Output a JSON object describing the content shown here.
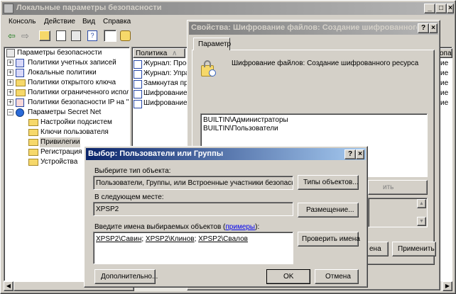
{
  "main": {
    "title": "Локальные параметры безопасности",
    "menu": [
      "Консоль",
      "Действие",
      "Вид",
      "Справка"
    ],
    "tree": [
      {
        "label": "Параметры безопасности",
        "level": 0
      },
      {
        "label": "Политики учетных записей",
        "level": 1
      },
      {
        "label": "Локальные политики",
        "level": 1
      },
      {
        "label": "Политики открытого ключа",
        "level": 1
      },
      {
        "label": "Политики ограниченного использ...",
        "level": 1
      },
      {
        "label": "Политики безопасности IP на \"Ло...",
        "level": 1
      },
      {
        "label": "Параметры Secret Net",
        "level": 1
      },
      {
        "label": "Настройки подсистем",
        "level": 2
      },
      {
        "label": "Ключи пользователя",
        "level": 2
      },
      {
        "label": "Привилегии",
        "level": 2
      },
      {
        "label": "Регистрация событий",
        "level": 2
      },
      {
        "label": "Устройства",
        "level": 2
      }
    ],
    "list_header": "Политика",
    "list_items": [
      "Журнал: Прос...",
      "Журнал: Упра...",
      "Замкнутая пр...",
      "Шифрование ...",
      "Шифрование ..."
    ],
    "right_header": "опа",
    "right_values": [
      "ие",
      "ие",
      "ие",
      "ие",
      "ие"
    ]
  },
  "props": {
    "title": "Свойства: Шифрование файлов: Создание шифрованного ресурса",
    "tab": "Параметр",
    "policy_name": "Шифрование файлов: Создание шифрованного ресурса",
    "members": [
      "BUILTIN\\Администраторы",
      "BUILTIN\\Пользователи"
    ],
    "remove_partial": "ить",
    "cancel_partial": "ена",
    "apply_label": "Применить"
  },
  "select": {
    "title": "Выбор: Пользователи или Группы",
    "object_type_label": "Выберите тип объекта:",
    "object_type_value": "Пользователи, Группы, или Встроенные участники безопасност",
    "object_types_button": "Типы объектов...",
    "location_label": "В следующем месте:",
    "location_value": "XPSP2",
    "location_button": "Размещение...",
    "names_label": "Введите имена выбираемых объектов (",
    "names_link": "примеры",
    "names_label_end": "):",
    "names": [
      "XPSP2\\Савин",
      "XPSP2\\Клинов",
      "XPSP2\\Свалов"
    ],
    "check_names_button": "Проверить имена",
    "advanced_button": "Дополнительно...",
    "ok_button": "OK",
    "cancel_button": "Отмена"
  },
  "colors": {
    "active_title": "#0a246a",
    "inactive_title": "#808080",
    "face": "#d4d0c8"
  }
}
